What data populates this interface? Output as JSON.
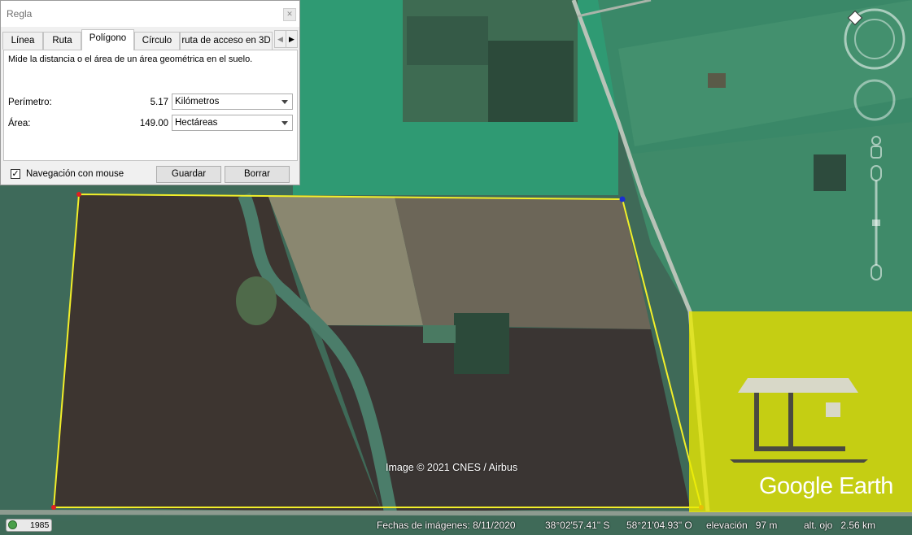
{
  "dialog": {
    "title": "Regla",
    "tabs": [
      {
        "label": "Línea"
      },
      {
        "label": "Ruta"
      },
      {
        "label": "Polígono"
      },
      {
        "label": "Círculo"
      },
      {
        "label": "ruta de acceso en 3D"
      }
    ],
    "active_tab": "Polígono",
    "description": "Mide la distancia o el área de un área geométrica en el suelo.",
    "perimeter": {
      "label": "Perímetro:",
      "value": "5.17",
      "unit": "Kilómetros"
    },
    "area": {
      "label": "Área:",
      "value": "149.00",
      "unit": "Hectáreas"
    },
    "mouse_nav": {
      "label": "Navegación con mouse",
      "checked": true
    },
    "save_label": "Guardar",
    "clear_label": "Borrar"
  },
  "map": {
    "attribution": "Image © 2021 CNES / Airbus",
    "logo": "Google Earth",
    "polygon_color": "#f2ef2a"
  },
  "status": {
    "year": "1985",
    "imagery_date": "Fechas de imágenes: 8/11/2020",
    "latitude": "38°02'57.41\" S",
    "longitude": "58°21'04.93\" O",
    "elevation": "elevación   97 m",
    "eye_altitude": "alt. ojo   2.56 km"
  }
}
